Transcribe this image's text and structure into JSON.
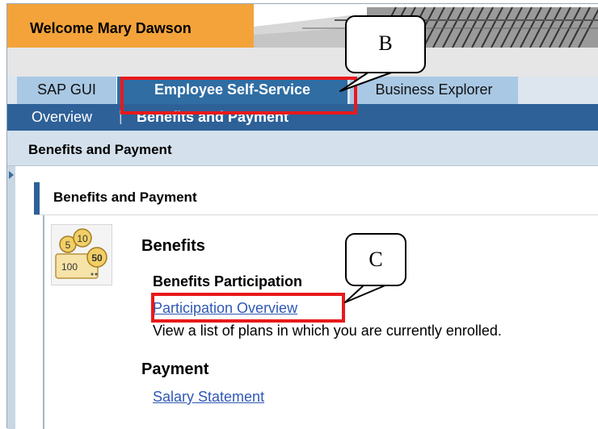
{
  "header": {
    "welcome": "Welcome Mary Dawson",
    "brand_color": "#f4a33b"
  },
  "top_tabs": [
    {
      "label": "SAP GUI"
    },
    {
      "label": "Employee Self-Service",
      "selected": true
    },
    {
      "label": "Business Explorer"
    }
  ],
  "sub_nav": {
    "items": [
      "Overview",
      "Benefits and Payment"
    ],
    "separator": "|",
    "active": "Benefits and Payment"
  },
  "page_title": "Benefits and Payment",
  "section": {
    "title": "Benefits and Payment",
    "icon": "coins-icon",
    "coin_labels": [
      "5",
      "10",
      "100",
      "50"
    ],
    "groups": [
      {
        "heading": "Benefits",
        "subheading": "Benefits Participation",
        "link": "Participation Overview",
        "description": "View a list of plans in which you are currently enrolled."
      },
      {
        "heading": "Payment",
        "link": "Salary Statement"
      }
    ]
  },
  "annotations": {
    "callout_b": "B",
    "callout_c": "C",
    "highlight_color": "#e8191b"
  }
}
